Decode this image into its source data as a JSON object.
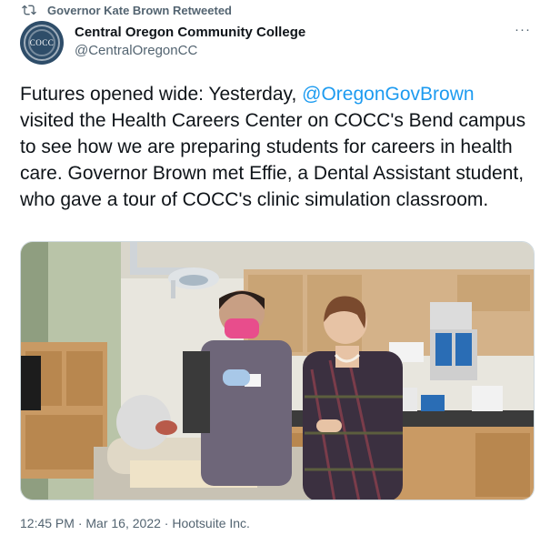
{
  "retweet": {
    "label": "Governor Kate Brown Retweeted",
    "icon": "retweet-icon"
  },
  "author": {
    "name": "Central Oregon Community College",
    "handle": "@CentralOregonCC",
    "avatar_text": "COCC",
    "avatar_color": "#2e4d69"
  },
  "more_button": "···",
  "tweet": {
    "text_before": "Futures opened wide: Yesterday, ",
    "mention": "@OregonGovBrown",
    "text_after": " visited the Health Careers Center on COCC's Bend campus to see how we are preparing students for careers in health care. Governor Brown met Effie, a Dental Assistant student, who gave a tour of COCC's clinic simulation classroom."
  },
  "meta": {
    "time": "12:45 PM",
    "separator1": " · ",
    "date": "Mar 16, 2022",
    "separator2": " · ",
    "source": "Hootsuite Inc."
  },
  "colors": {
    "link": "#1d9bf0",
    "secondary_text": "#536471",
    "border": "#cfd9de"
  }
}
